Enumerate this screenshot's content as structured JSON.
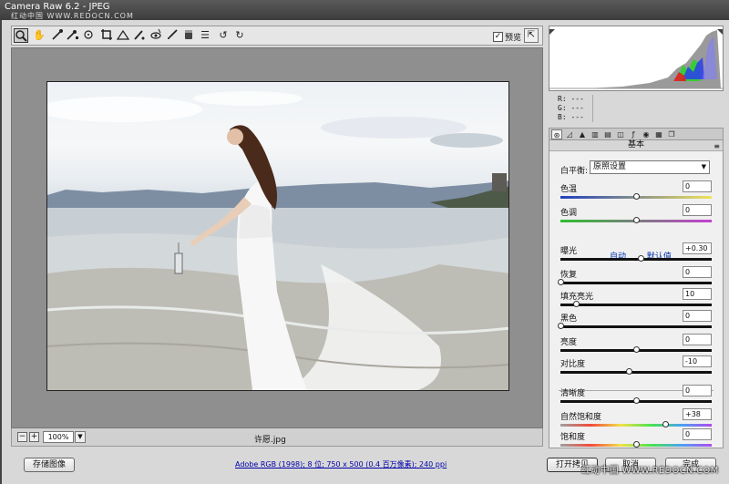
{
  "window": {
    "title": "Camera Raw 6.2 - JPEG",
    "watermark_top": "红动中国 WWW.REDOCN.COM"
  },
  "toolbar": {
    "preview_label": "预览",
    "preview_checked": true,
    "tools": [
      "zoom-icon",
      "hand-icon",
      "eyedropper-icon",
      "color-sampler-icon",
      "target-adjust-icon",
      "crop-icon",
      "straighten-icon",
      "spot-removal-icon",
      "red-eye-icon",
      "adjustment-brush-icon",
      "graduated-filter-icon",
      "preferences-icon",
      "rotate-left-icon",
      "rotate-right-icon"
    ]
  },
  "canvas": {
    "zoom": "100%",
    "filename": "许愿.jpg"
  },
  "readout": {
    "r": "R:  ---",
    "g": "G:  ---",
    "b": "B:  ---"
  },
  "panel": {
    "title": "基本",
    "white_balance_label": "白平衡:",
    "white_balance_value": "原照设置",
    "auto_label": "自动",
    "default_label": "默认值",
    "controls": [
      {
        "label": "色温",
        "value": "0",
        "level": 0.5
      },
      {
        "label": "色调",
        "value": "0",
        "level": 0.5
      },
      {
        "label": "曝光",
        "value": "+0.30",
        "level": 0.53
      },
      {
        "label": "恢复",
        "value": "0",
        "level": 0.0
      },
      {
        "label": "填充亮光",
        "value": "10",
        "level": 0.1
      },
      {
        "label": "黑色",
        "value": "0",
        "level": 0.0
      },
      {
        "label": "亮度",
        "value": "0",
        "level": 0.5
      },
      {
        "label": "对比度",
        "value": "-10",
        "level": 0.45
      },
      {
        "label": "清晰度",
        "value": "0",
        "level": 0.5
      },
      {
        "label": "自然饱和度",
        "value": "+38",
        "level": 0.69
      },
      {
        "label": "饱和度",
        "value": "0",
        "level": 0.5
      }
    ]
  },
  "footer": {
    "save_label": "存储图像",
    "workflow": "Adobe RGB (1998); 8 位; 750 x 500 (0.4 百万像素); 240 ppi",
    "open_label": "打开拷贝",
    "cancel_label": "取消",
    "done_label": "完成",
    "watermark": "红动中国 WWW.REDOCN.COM"
  }
}
